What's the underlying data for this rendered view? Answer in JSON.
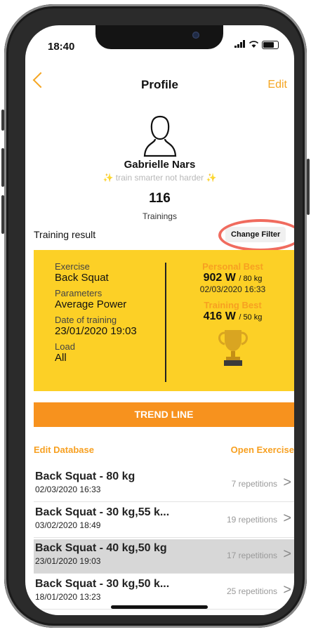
{
  "status_bar": {
    "time": "18:40",
    "signal": "..ıl"
  },
  "nav": {
    "title": "Profile",
    "edit_label": "Edit"
  },
  "profile": {
    "name": "Gabrielle Nars",
    "tagline": "train smarter not harder",
    "tagline_sparkle": "✨",
    "trainings_count": "116",
    "trainings_label": "Trainings"
  },
  "training_result": {
    "title": "Training result",
    "filter_button": "Change Filter"
  },
  "result_card": {
    "exercise_label": "Exercise",
    "exercise_value": "Back Squat",
    "parameters_label": "Parameters",
    "parameters_value": "Average Power",
    "date_label": "Date of training",
    "date_value": "23/01/2020 19:03",
    "load_label": "Load",
    "load_value": "All",
    "personal_best_label": "Personal Best",
    "personal_best_value": "902 W",
    "personal_best_unit": "/ 80 kg",
    "personal_best_date": "02/03/2020 16:33",
    "training_best_label": "Training Best",
    "training_best_value": "416 W",
    "training_best_unit": "/ 50 kg"
  },
  "trend_button": "TREND LINE",
  "links": {
    "edit_database": "Edit Database",
    "open_exercise": "Open Exercise"
  },
  "sessions": [
    {
      "title": "Back Squat - 80 kg",
      "date": "02/03/2020 16:33",
      "reps": "7 repetitions",
      "selected": false
    },
    {
      "title": "Back Squat - 30 kg,55 k...",
      "date": "03/02/2020 18:49",
      "reps": "19 repetitions",
      "selected": false
    },
    {
      "title": "Back Squat - 40 kg,50 kg",
      "date": "23/01/2020 19:03",
      "reps": "17 repetitions",
      "selected": true
    },
    {
      "title": "Back Squat - 30 kg,50 k...",
      "date": "18/01/2020 13:23",
      "reps": "25 repetitions",
      "selected": false
    }
  ],
  "chevron": ">",
  "colors": {
    "accent": "#f7a021",
    "card": "#fcd026",
    "trend": "#f7921e",
    "ring": "#f06b5e"
  }
}
